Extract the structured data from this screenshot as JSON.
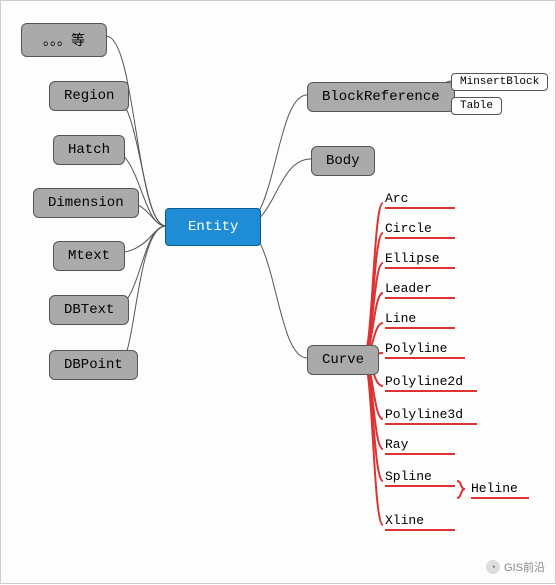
{
  "root": {
    "label": "Entity"
  },
  "left_children": [
    {
      "id": "etc",
      "label": "。。。等"
    },
    {
      "id": "region",
      "label": "Region"
    },
    {
      "id": "hatch",
      "label": "Hatch"
    },
    {
      "id": "dim",
      "label": "Dimension"
    },
    {
      "id": "mtext",
      "label": "Mtext"
    },
    {
      "id": "dbtext",
      "label": "DBText"
    },
    {
      "id": "dbpt",
      "label": "DBPoint"
    }
  ],
  "right_children": [
    {
      "id": "blockref",
      "label": "BlockReference",
      "children": [
        {
          "id": "minsert",
          "label": "MinsertBlock"
        },
        {
          "id": "table",
          "label": "Table"
        }
      ]
    },
    {
      "id": "body",
      "label": "Body"
    },
    {
      "id": "curve",
      "label": "Curve",
      "children": [
        {
          "id": "arc",
          "label": "Arc"
        },
        {
          "id": "circle",
          "label": "Circle"
        },
        {
          "id": "ellipse",
          "label": "Ellipse"
        },
        {
          "id": "leader",
          "label": "Leader"
        },
        {
          "id": "line",
          "label": "Line"
        },
        {
          "id": "poly",
          "label": "Polyline"
        },
        {
          "id": "poly2d",
          "label": "Polyline2d"
        },
        {
          "id": "poly3d",
          "label": "Polyline3d"
        },
        {
          "id": "ray",
          "label": "Ray"
        },
        {
          "id": "spline",
          "label": "Spline",
          "children": [
            {
              "id": "heline",
              "label": "Heline"
            }
          ]
        },
        {
          "id": "xline",
          "label": "Xline"
        }
      ]
    }
  ],
  "watermark": {
    "text": "GIS前沿",
    "icon": "◔"
  },
  "chart_data": {
    "type": "table",
    "title": "Entity class hierarchy (mind map)",
    "root": "Entity",
    "edges": [
      [
        "Entity",
        "。。。等"
      ],
      [
        "Entity",
        "Region"
      ],
      [
        "Entity",
        "Hatch"
      ],
      [
        "Entity",
        "Dimension"
      ],
      [
        "Entity",
        "Mtext"
      ],
      [
        "Entity",
        "DBText"
      ],
      [
        "Entity",
        "DBPoint"
      ],
      [
        "Entity",
        "BlockReference"
      ],
      [
        "Entity",
        "Body"
      ],
      [
        "Entity",
        "Curve"
      ],
      [
        "BlockReference",
        "MinsertBlock"
      ],
      [
        "BlockReference",
        "Table"
      ],
      [
        "Curve",
        "Arc"
      ],
      [
        "Curve",
        "Circle"
      ],
      [
        "Curve",
        "Ellipse"
      ],
      [
        "Curve",
        "Leader"
      ],
      [
        "Curve",
        "Line"
      ],
      [
        "Curve",
        "Polyline"
      ],
      [
        "Curve",
        "Polyline2d"
      ],
      [
        "Curve",
        "Polyline3d"
      ],
      [
        "Curve",
        "Ray"
      ],
      [
        "Curve",
        "Spline"
      ],
      [
        "Curve",
        "Xline"
      ],
      [
        "Spline",
        "Heline"
      ]
    ]
  }
}
